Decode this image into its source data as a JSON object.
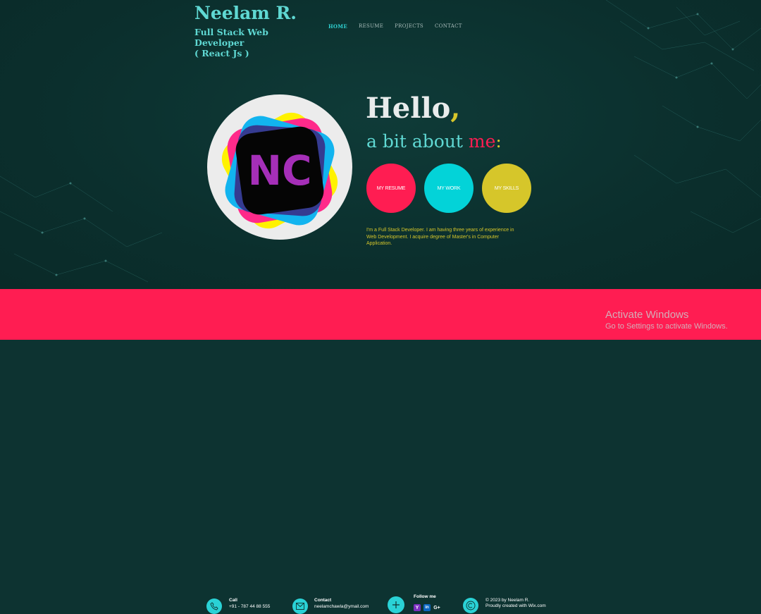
{
  "brand": {
    "name": "Neelam R.",
    "subtitle_line1": "Full Stack Web Developer",
    "subtitle_line2": "( React Js )"
  },
  "nav": {
    "items": [
      "HOME",
      "RESUME",
      "PROJECTS",
      "CONTACT"
    ],
    "active": "HOME"
  },
  "logo": {
    "monogram": "NC"
  },
  "hero": {
    "hello": "Hello",
    "hello_comma": ",",
    "about_prefix": "a bit about ",
    "about_me": "me",
    "about_colon": ":",
    "buttons": [
      "MY RESUME",
      "MY WORK",
      "MY SKILLS"
    ],
    "bio": "I'm a Full Stack Developer. I am having three years of experience in Web Development. I acquire degree of Master's in Computer Application."
  },
  "footer": {
    "call_label": "Call",
    "call_value": "+91 - 787 44 88 555",
    "contact_label": "Contact",
    "contact_value": "neelamchawla@ymail.com",
    "follow_label": "Follow me",
    "social": [
      "Y",
      "in",
      "G+"
    ],
    "copyright_line1": "© 2023 by Neelam R.",
    "copyright_line2": "Proudly created with Wix.com"
  },
  "overlay": {
    "activate_title": "Activate Windows",
    "activate_sub": "Go to Settings to activate Windows."
  },
  "colors": {
    "background": "#0d3331",
    "teal": "#5fd8d3",
    "pink": "#ff1d52",
    "cyan": "#03d3d8",
    "yellow": "#d6c62a"
  }
}
